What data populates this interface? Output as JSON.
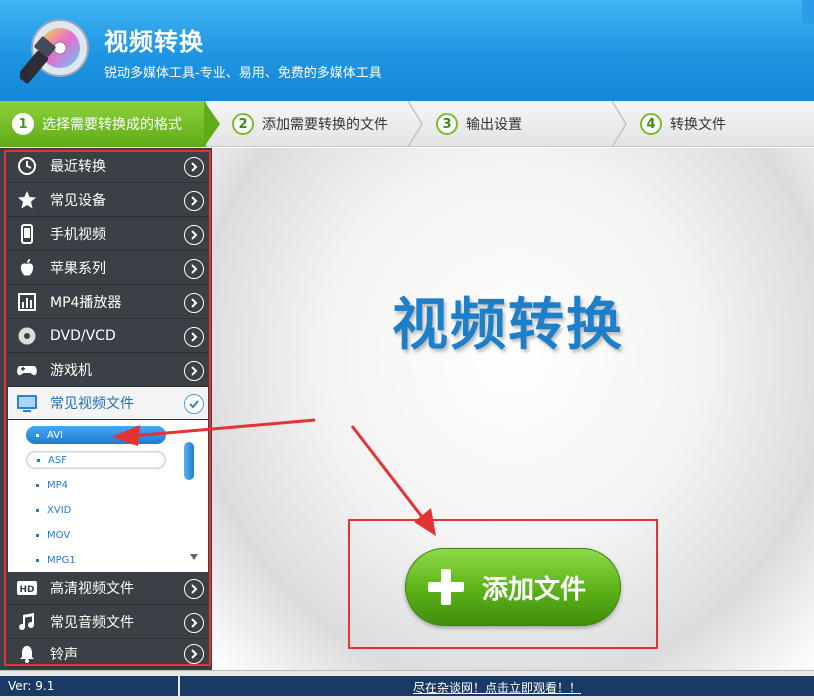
{
  "app": {
    "title": "视频转换",
    "subtitle": "锐动多媒体工具-专业、易用、免费的多媒体工具"
  },
  "steps": [
    {
      "num": "1",
      "label": "选择需要转换成的格式",
      "active": true
    },
    {
      "num": "2",
      "label": "添加需要转换的文件",
      "active": false
    },
    {
      "num": "3",
      "label": "输出设置",
      "active": false
    },
    {
      "num": "4",
      "label": "转换文件",
      "active": false
    }
  ],
  "sidebar": {
    "categories": [
      {
        "label": "最近转换",
        "icon": "clock-icon"
      },
      {
        "label": "常见设备",
        "icon": "star-icon"
      },
      {
        "label": "手机视频",
        "icon": "phone-icon"
      },
      {
        "label": "苹果系列",
        "icon": "apple-icon"
      },
      {
        "label": "MP4播放器",
        "icon": "mp4-player-icon"
      },
      {
        "label": "DVD/VCD",
        "icon": "disc-icon"
      },
      {
        "label": "游戏机",
        "icon": "gamepad-icon"
      },
      {
        "label": "常见视频文件",
        "icon": "monitor-icon",
        "active": true
      },
      {
        "label": "高清视频文件",
        "icon": "hd-icon"
      },
      {
        "label": "常见音频文件",
        "icon": "music-note-icon"
      },
      {
        "label": "铃声",
        "icon": "bell-icon"
      }
    ],
    "formats": [
      "AVI",
      "ASF",
      "MP4",
      "XVID",
      "MOV",
      "MPG1"
    ],
    "selected_format": "AVI"
  },
  "main": {
    "big_title": "视频转换",
    "add_button": "添加文件"
  },
  "status": {
    "version": "Ver: 9.1",
    "ad_text": "尽在杂谈网！点击立即观看！！"
  },
  "colors": {
    "header": "#1f95e2",
    "sidebar": "#3b4046",
    "accent_green": "#5fb51b",
    "highlight_red": "#e53232",
    "title_blue": "#1e7fc9"
  }
}
